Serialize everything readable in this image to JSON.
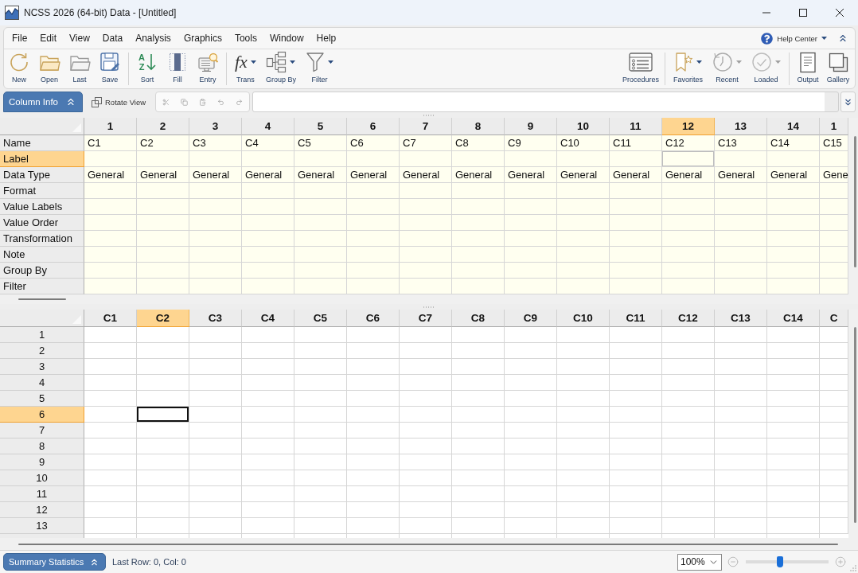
{
  "window": {
    "title": "NCSS 2026 (64-bit) Data - [Untitled]"
  },
  "menu_bar": {
    "items": [
      "File",
      "Edit",
      "View",
      "Data",
      "Analysis",
      "Graphics",
      "Tools",
      "Window",
      "Help"
    ],
    "help_center": {
      "label": "Help Center"
    }
  },
  "toolbar": {
    "left_groups": [
      {
        "items": [
          {
            "label": "New"
          },
          {
            "label": "Open"
          },
          {
            "label": "Last"
          },
          {
            "label": "Save"
          }
        ]
      },
      {
        "items": [
          {
            "label": "Sort",
            "glyph": "AZ"
          },
          {
            "label": "Fill"
          },
          {
            "label": "Entry"
          }
        ]
      },
      {
        "items": [
          {
            "label": "Trans",
            "glyph": "fx",
            "dropdown": {
              "disabled": false
            }
          },
          {
            "label": "Group By",
            "dropdown": {
              "disabled": false
            }
          },
          {
            "label": "Filter",
            "dropdown": {
              "disabled": false
            }
          }
        ]
      }
    ],
    "right_groups": [
      {
        "items": [
          {
            "label": "Procedures"
          }
        ]
      },
      {
        "items": [
          {
            "label": "Favorites",
            "dropdown": {
              "disabled": false
            }
          },
          {
            "label": "Recent",
            "dropdown": {
              "disabled": true
            }
          },
          {
            "label": "Loaded",
            "dropdown": {
              "disabled": true
            }
          }
        ]
      },
      {
        "items": [
          {
            "label": "Output"
          },
          {
            "label": "Gallery"
          }
        ]
      }
    ]
  },
  "edit_bar": {
    "column_info_button": "Column Info",
    "rotate_view_button": "Rotate View",
    "edit_buttons": [
      {
        "disabled": true
      },
      {
        "disabled": true
      },
      {
        "disabled": true
      },
      {
        "disabled": true
      },
      {
        "disabled": true
      }
    ]
  },
  "column_info": {
    "columns": [
      {
        "label": "1",
        "selected": false
      },
      {
        "label": "2",
        "selected": false
      },
      {
        "label": "3",
        "selected": false
      },
      {
        "label": "4",
        "selected": false
      },
      {
        "label": "5",
        "selected": false
      },
      {
        "label": "6",
        "selected": false
      },
      {
        "label": "7",
        "selected": false
      },
      {
        "label": "8",
        "selected": false
      },
      {
        "label": "9",
        "selected": false
      },
      {
        "label": "10",
        "selected": false
      },
      {
        "label": "11",
        "selected": false
      },
      {
        "label": "12",
        "selected": true
      },
      {
        "label": "13",
        "selected": false
      },
      {
        "label": "14",
        "selected": false
      },
      {
        "label": "1",
        "selected": false
      }
    ],
    "rows": [
      {
        "label": "Name",
        "selected": false,
        "cells": [
          "C1",
          "C2",
          "C3",
          "C4",
          "C5",
          "C6",
          "C7",
          "C8",
          "C9",
          "C10",
          "C11",
          "C12",
          "C13",
          "C14",
          "C15"
        ]
      },
      {
        "label": "Label",
        "selected": true
      },
      {
        "label": "Data Type",
        "selected": false,
        "cells": [
          "General",
          "General",
          "General",
          "General",
          "General",
          "General",
          "General",
          "General",
          "General",
          "General",
          "General",
          "General",
          "General",
          "General",
          "Gene"
        ]
      },
      {
        "label": "Format",
        "selected": false
      },
      {
        "label": "Value Labels",
        "selected": false
      },
      {
        "label": "Value Order",
        "selected": false
      },
      {
        "label": "Transformation",
        "selected": false
      },
      {
        "label": "Note",
        "selected": false
      },
      {
        "label": "Group By",
        "selected": false
      },
      {
        "label": "Filter",
        "selected": false
      }
    ]
  },
  "data_grid": {
    "columns": [
      {
        "label": "C1",
        "selected": false
      },
      {
        "label": "C2",
        "selected": true
      },
      {
        "label": "C3",
        "selected": false
      },
      {
        "label": "C4",
        "selected": false
      },
      {
        "label": "C5",
        "selected": false
      },
      {
        "label": "C6",
        "selected": false
      },
      {
        "label": "C7",
        "selected": false
      },
      {
        "label": "C8",
        "selected": false
      },
      {
        "label": "C9",
        "selected": false
      },
      {
        "label": "C10",
        "selected": false
      },
      {
        "label": "C11",
        "selected": false
      },
      {
        "label": "C12",
        "selected": false
      },
      {
        "label": "C13",
        "selected": false
      },
      {
        "label": "C14",
        "selected": false
      },
      {
        "label": "C",
        "selected": false
      }
    ],
    "rows": [
      {
        "label": "1",
        "selected": false
      },
      {
        "label": "2",
        "selected": false
      },
      {
        "label": "3",
        "selected": false
      },
      {
        "label": "4",
        "selected": false
      },
      {
        "label": "5",
        "selected": false
      },
      {
        "label": "6",
        "selected": true
      },
      {
        "label": "7",
        "selected": false
      },
      {
        "label": "8",
        "selected": false
      },
      {
        "label": "9",
        "selected": false
      },
      {
        "label": "10",
        "selected": false
      },
      {
        "label": "11",
        "selected": false
      },
      {
        "label": "12",
        "selected": false
      },
      {
        "label": "13",
        "selected": false
      }
    ]
  },
  "status_bar": {
    "summary_button": "Summary Statistics",
    "position": "Last Row: 0, Col: 0",
    "zoom": {
      "value": "100%",
      "level": 0.41
    }
  }
}
